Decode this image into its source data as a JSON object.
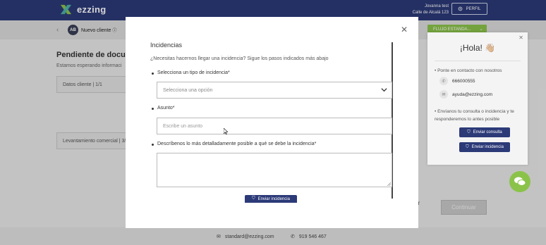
{
  "topbar": {
    "logo_text": "ezzing",
    "user_name": "Jovanna test",
    "user_address": "Calle de Alcalá 123",
    "profile_button": "PERFIL"
  },
  "subheader": {
    "avatar_initials": "AB",
    "client_label": "Nuevo cliente",
    "flow_button": "FLUJO ESTANDA..."
  },
  "page": {
    "title": "Pendiente de docum",
    "subtitle": "Estamos esperando informaci",
    "box1_label": "Datos cliente | 1/1",
    "box2_label": "Levantamiento comercial | 3/",
    "cancel_label": "ar",
    "continue_label": "Continuar"
  },
  "footer": {
    "email": "standard@ezzing.com",
    "phone": "919 546 467"
  },
  "help_panel": {
    "greeting": "¡Hola! 👋🏼",
    "contact_intro": "Ponte en contacto con nosotros",
    "phone": "666000555",
    "email": "ayuda@ezzing.com",
    "send_intro": "Envíanos tu consulta o incidencia y te responderemos lo antes posible",
    "consult_button": "Enviar consulta",
    "incident_button": "Enviar incidencia"
  },
  "modal": {
    "title": "Incidencias",
    "intro": "¿Necesitas hacernos llegar una incidencia? Sigue los pasos indicados más abajo",
    "type_label": "Selecciona un tipo de incidencia*",
    "type_placeholder": "Selecciona una opción",
    "subject_label": "Asunto*",
    "subject_placeholder": "Escribe un asunto",
    "description_label": "Descríbenos lo más detalladamente posible a qué se debe la incidencia*",
    "submit_button": "Enviar incidencia"
  },
  "colors": {
    "brand_navy": "#2c3a78",
    "brand_green": "#8bc34a"
  }
}
